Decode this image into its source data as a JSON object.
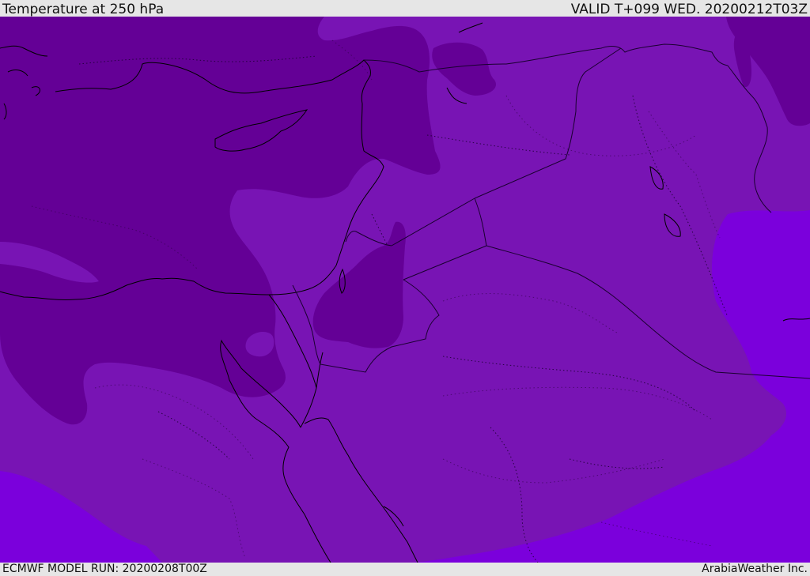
{
  "header": {
    "title": "Temperature at 250 hPa",
    "valid": "VALID T+099 WED. 20200212T03Z"
  },
  "footer": {
    "model_run": "ECMWF MODEL RUN: 20200208T00Z",
    "credit": "ArabiaWeather Inc."
  },
  "colors": {
    "zone_cold": "#640096",
    "zone_mid": "#7814b4",
    "zone_warm": "#7b00dc",
    "coast": "#000000",
    "border": "#1a0030"
  }
}
